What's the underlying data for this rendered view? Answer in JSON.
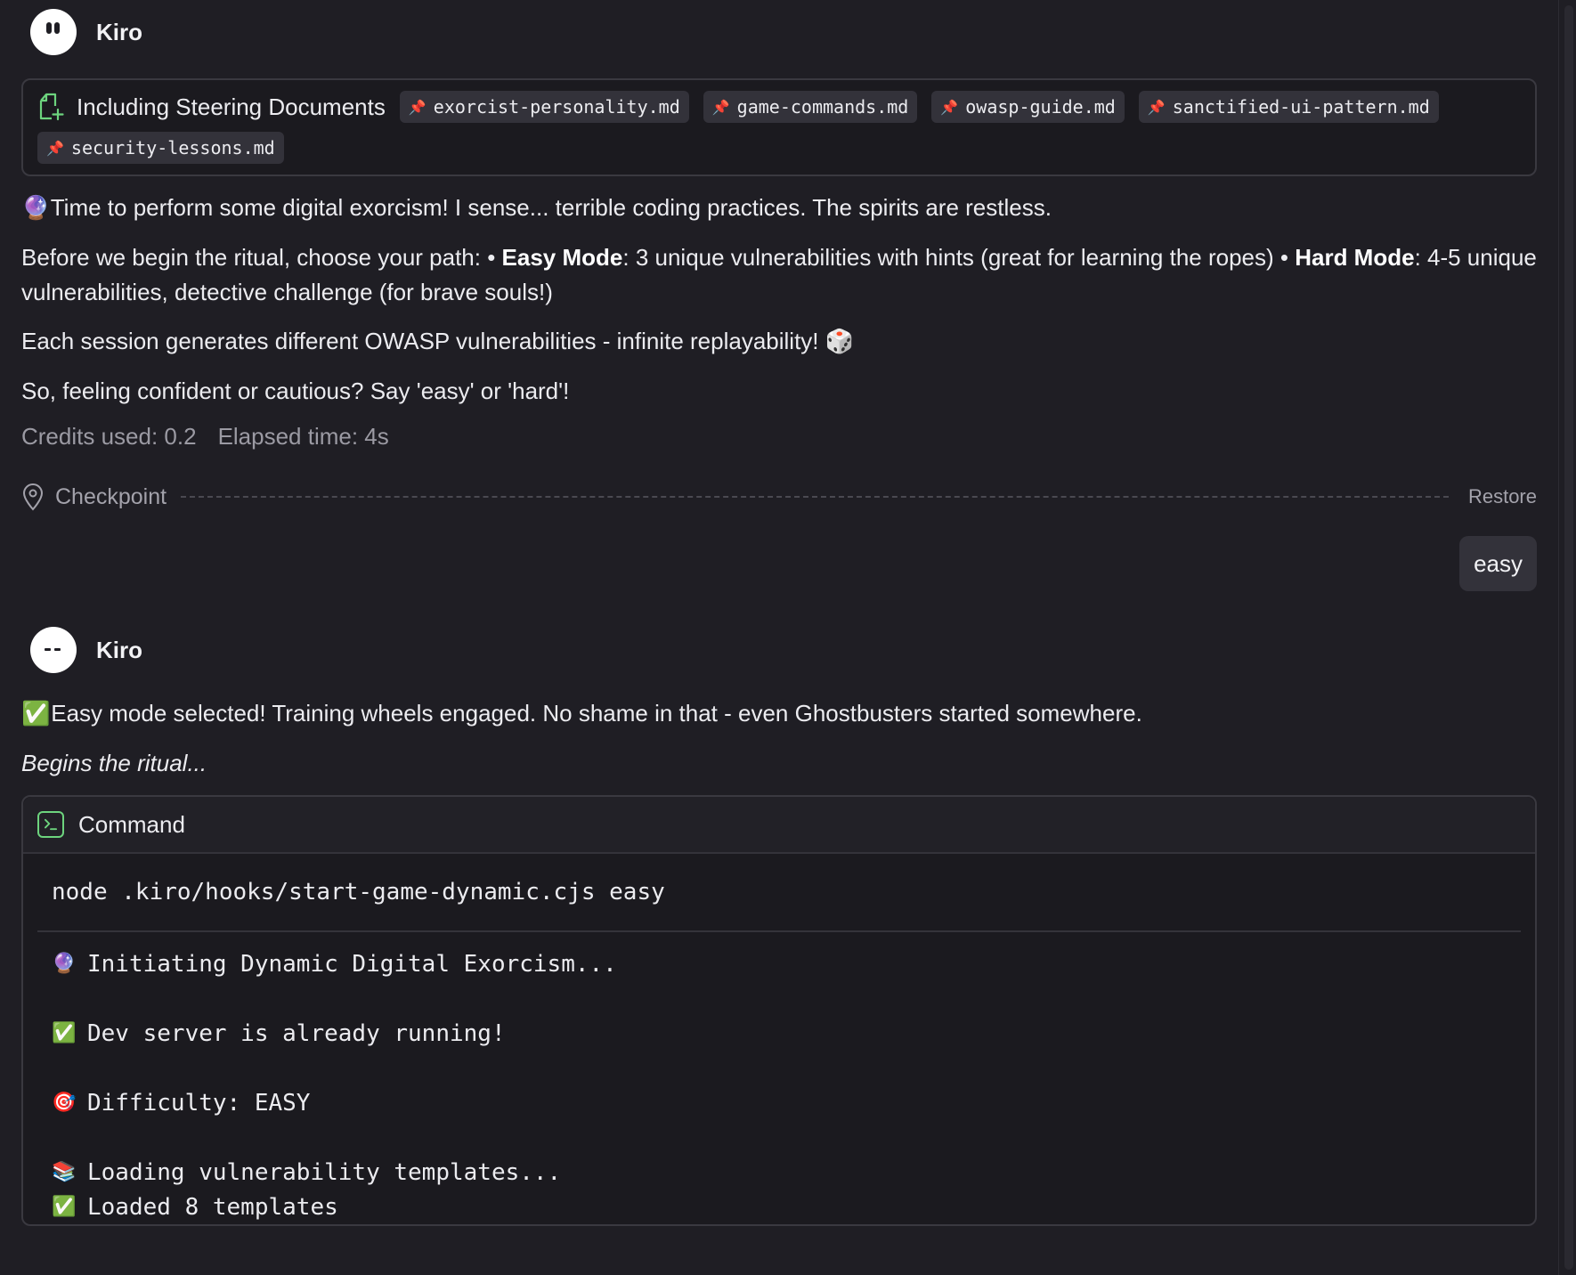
{
  "agent": {
    "name": "Kiro"
  },
  "steering": {
    "title": "Including Steering Documents",
    "docs": [
      "exorcist-personality.md",
      "game-commands.md",
      "owasp-guide.md",
      "sanctified-ui-pattern.md",
      "security-lessons.md"
    ]
  },
  "message1": {
    "p1": "Time to perform some digital exorcism! I sense... terrible coding practices. The spirits are restless.",
    "p2_intro": "Before we begin the ritual, choose your path: • ",
    "p2_easy_label": "Easy Mode",
    "p2_easy_text": ": 3 unique vulnerabilities with hints (great for learning the ropes) • ",
    "p2_hard_label": "Hard Mode",
    "p2_hard_text": ": 4-5 unique vulnerabilities, detective challenge (for brave souls!)",
    "p3": "Each session generates different OWASP vulnerabilities - infinite replayability!",
    "p4": "So, feeling confident or cautious? Say 'easy' or 'hard'!",
    "credits": "Credits used: 0.2",
    "elapsed": "Elapsed time: 4s"
  },
  "checkpoint": {
    "label": "Checkpoint",
    "restore": "Restore"
  },
  "user_message": "easy",
  "message2": {
    "p1": "Easy mode selected! Training wheels engaged. No shame in that - even Ghostbusters started somewhere.",
    "p2": "Begins the ritual..."
  },
  "command": {
    "title": "Command",
    "cmd": "node .kiro/hooks/start-game-dynamic.cjs easy",
    "output": {
      "l1": "Initiating Dynamic Digital Exorcism...",
      "l2": "Dev server is already running!",
      "l3": "Difficulty: EASY",
      "l4": "Loading vulnerability templates...",
      "l5": "Loaded 8 templates"
    }
  },
  "colors": {
    "accent_green": "#6dd47e",
    "chip_pin": "#5aa7e6",
    "background": "#1f1e24"
  },
  "icons": [
    "crystal-ball-icon",
    "dice-icon",
    "check-icon",
    "target-icon",
    "books-icon",
    "pin-icon",
    "location-pin-icon",
    "terminal-icon",
    "doc-plus-icon"
  ]
}
